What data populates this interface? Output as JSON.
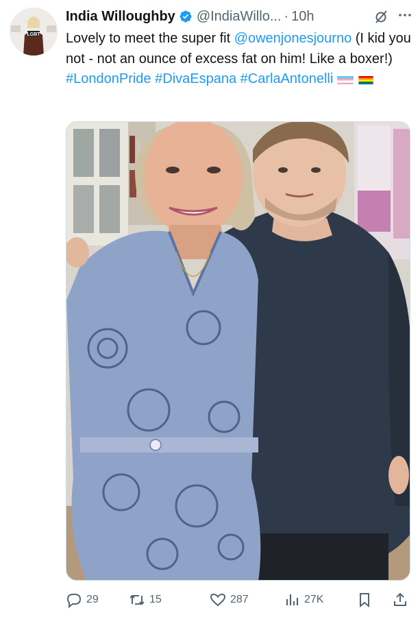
{
  "tweet": {
    "author_name": "India Willoughby",
    "handle": "@IndiaWillo...",
    "separator": "·",
    "time": "10h",
    "text_parts": {
      "t1": "Lovely to meet the super fit ",
      "mention": "@owenjonesjourno",
      "t2": " (I kid you not - not an ounce of excess fat on him! Like a boxer!) ",
      "tag1": "#LondonPride",
      "tag2": "#DivaEspana",
      "tag3": "#CarlaAntonelli"
    },
    "flags": [
      "transgender-flag",
      "rainbow-flag"
    ],
    "avatar_badge_text": "LGBT"
  },
  "actions": {
    "replies": "29",
    "reposts": "15",
    "likes": "287",
    "views": "27K"
  },
  "icons": {
    "verified": "verified-badge-icon",
    "grok": "grok-icon",
    "more": "more-icon",
    "reply": "reply-icon",
    "repost": "repost-icon",
    "like": "heart-icon",
    "views": "views-icon",
    "bookmark": "bookmark-icon",
    "share": "share-icon"
  },
  "colors": {
    "link": "#1d9bf0",
    "text": "#0f1419",
    "muted": "#536471",
    "shirt": "#2e3a4a"
  }
}
